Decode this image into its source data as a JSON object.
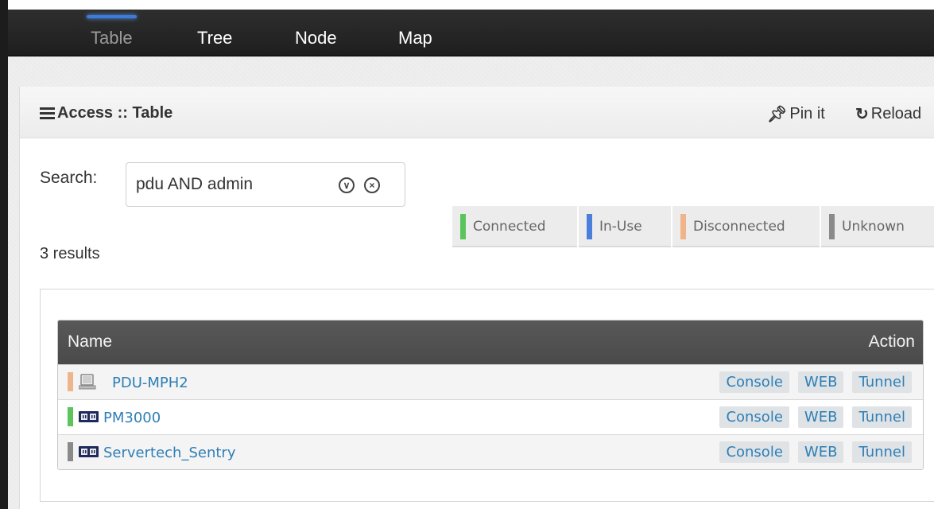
{
  "nav": {
    "tabs": [
      {
        "label": "Table",
        "active": true
      },
      {
        "label": "Tree",
        "active": false
      },
      {
        "label": "Node",
        "active": false
      },
      {
        "label": "Map",
        "active": false
      }
    ]
  },
  "panel": {
    "title": "Access :: Table",
    "pin_label": "Pin it",
    "reload_label": "Reload"
  },
  "search": {
    "label": "Search:",
    "value": "pdu AND admin"
  },
  "results_text": "3 results",
  "legend": [
    {
      "label": "Connected",
      "color": "#5cc45c"
    },
    {
      "label": "In-Use",
      "color": "#4b7fdc"
    },
    {
      "label": "Disconnected",
      "color": "#f0b48a"
    },
    {
      "label": "Unknown",
      "color": "#8a8a8a"
    }
  ],
  "table": {
    "headers": {
      "name": "Name",
      "action": "Action"
    },
    "rows": [
      {
        "name": "PDU-MPH2",
        "status_color": "#f0b48a",
        "icon": "monitor-icon",
        "actions": [
          "Console",
          "WEB",
          "Tunnel"
        ]
      },
      {
        "name": "PM3000",
        "status_color": "#5cc45c",
        "icon": "power-strip-icon",
        "actions": [
          "Console",
          "WEB",
          "Tunnel"
        ]
      },
      {
        "name": "Servertech_Sentry",
        "status_color": "#8a8a8a",
        "icon": "power-strip-icon",
        "actions": [
          "Console",
          "WEB",
          "Tunnel"
        ]
      }
    ]
  }
}
